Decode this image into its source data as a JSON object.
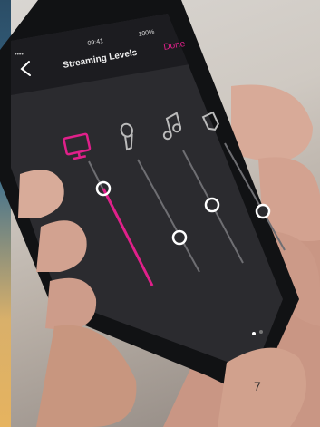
{
  "status_bar": {
    "carrier": "•••• ",
    "time": "09:41",
    "battery": "100%"
  },
  "nav": {
    "back_icon": "chevron-left-icon",
    "title": "Streaming Levels",
    "done_label": "Done"
  },
  "channels": [
    {
      "icon": "monitor-icon",
      "active": true,
      "level": 0.72
    },
    {
      "icon": "microphone-icon",
      "active": false,
      "level": 0.33
    },
    {
      "icon": "music-note-icon",
      "active": false,
      "level": 0.57
    },
    {
      "icon": "tag-icon",
      "active": false,
      "level": 0.55
    }
  ],
  "pager": {
    "pages": 2,
    "current": 1
  },
  "page_number": "7",
  "colors": {
    "accent": "#e0208a",
    "screen_bg": "#2b2b2f",
    "track": "#6e6e72",
    "knob": "#ffffff"
  }
}
